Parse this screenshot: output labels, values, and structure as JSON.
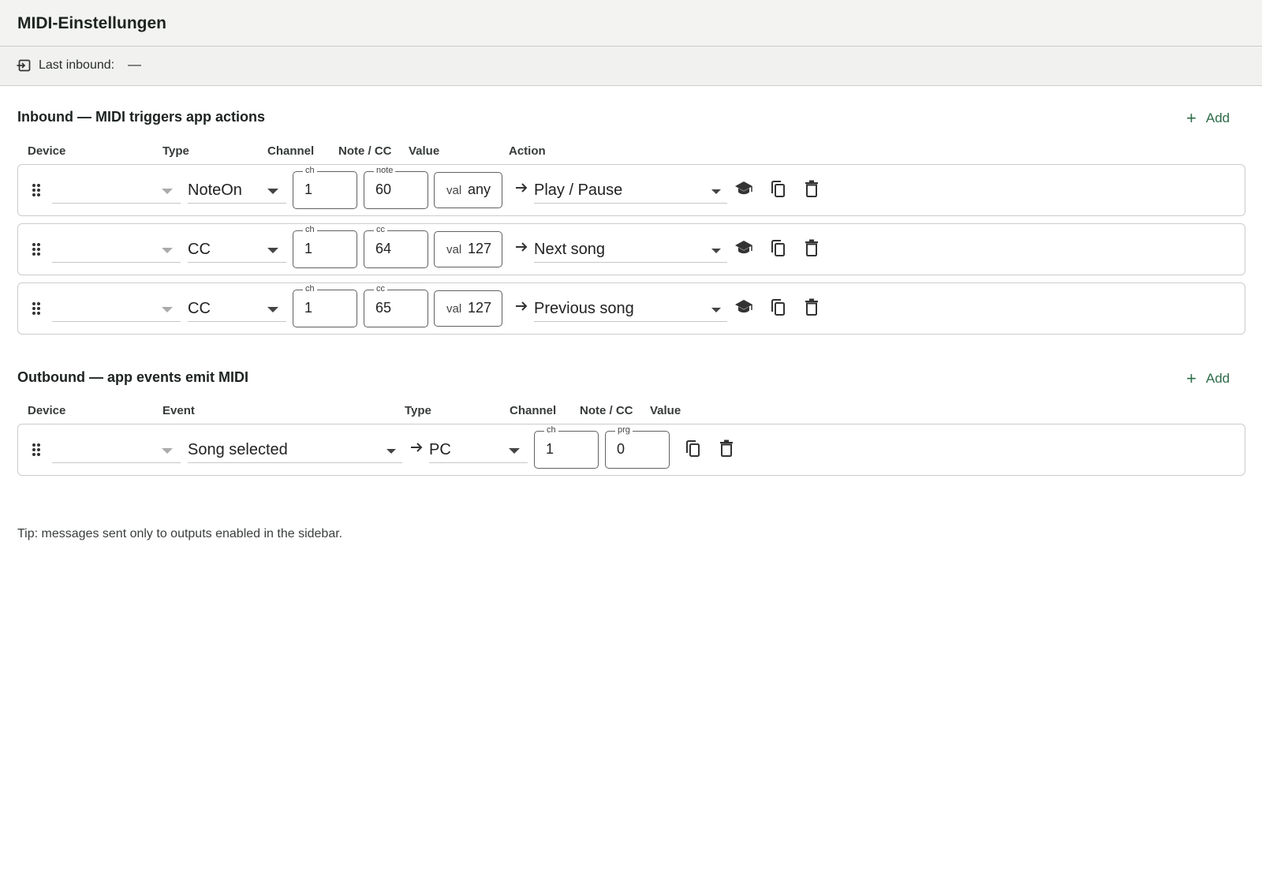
{
  "header": {
    "title": "MIDI-Einstellungen"
  },
  "status": {
    "icon": "inbound-arrow-icon",
    "label": "Last inbound:",
    "value": "—"
  },
  "inbound": {
    "title": "Inbound — MIDI triggers app actions",
    "add_label": "Add",
    "columns": {
      "device": "Device",
      "type": "Type",
      "channel": "Channel",
      "note": "Note / CC",
      "value": "Value",
      "action": "Action"
    },
    "rows": [
      {
        "device": "",
        "type": "NoteOn",
        "ch_legend": "ch",
        "channel": "1",
        "num_legend": "note",
        "number": "60",
        "val_prefix": "val",
        "value": "any",
        "action": "Play / Pause"
      },
      {
        "device": "",
        "type": "CC",
        "ch_legend": "ch",
        "channel": "1",
        "num_legend": "cc",
        "number": "64",
        "val_prefix": "val",
        "value": "127",
        "action": "Next song"
      },
      {
        "device": "",
        "type": "CC",
        "ch_legend": "ch",
        "channel": "1",
        "num_legend": "cc",
        "number": "65",
        "val_prefix": "val",
        "value": "127",
        "action": "Previous song"
      }
    ]
  },
  "outbound": {
    "title": "Outbound — app events emit MIDI",
    "add_label": "Add",
    "columns": {
      "device": "Device",
      "event": "Event",
      "type": "Type",
      "channel": "Channel",
      "note": "Note / CC",
      "value": "Value"
    },
    "rows": [
      {
        "device": "",
        "event": "Song selected",
        "type": "PC",
        "ch_legend": "ch",
        "channel": "1",
        "prg_legend": "prg",
        "program": "0"
      }
    ]
  },
  "tip": "Tip: messages sent only to outputs enabled in the sidebar.",
  "icons": [
    "inbound-arrow-icon",
    "plus-icon",
    "drag-handle-icon",
    "chevron-down-icon",
    "arrow-right-icon",
    "learn-icon",
    "copy-icon",
    "delete-icon"
  ],
  "colors": {
    "accent": "#2f6d4a",
    "header_bg": "#f3f4f2",
    "border": "#c9cdc9"
  }
}
